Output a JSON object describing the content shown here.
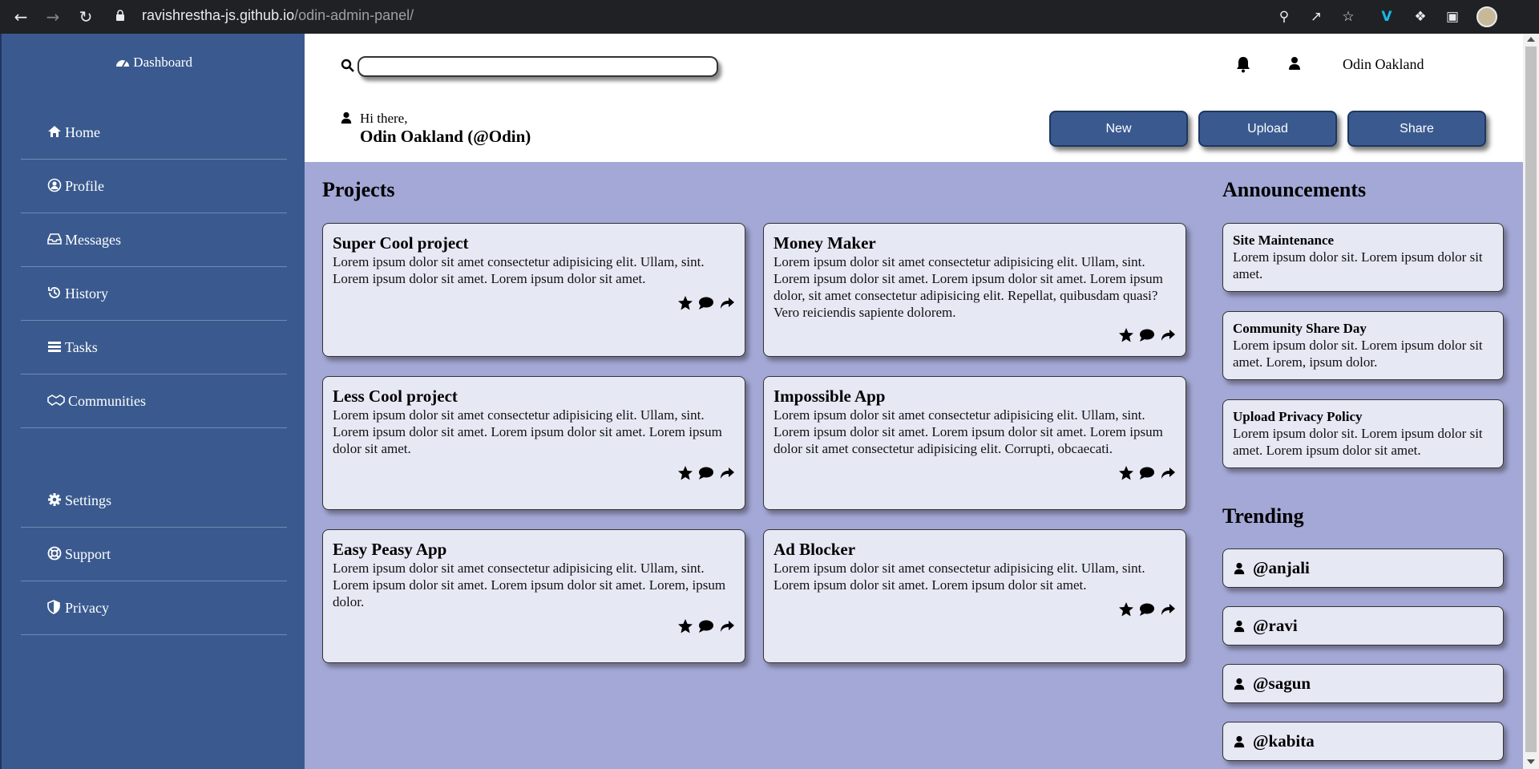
{
  "browser": {
    "url_host": "ravishrestha-js.github.io",
    "url_path": "/odin-admin-panel/"
  },
  "sidebar": {
    "dashboard_label": "Dashboard",
    "items": [
      {
        "label": "Home",
        "icon": "home-icon"
      },
      {
        "label": "Profile",
        "icon": "profile-icon"
      },
      {
        "label": "Messages",
        "icon": "inbox-icon"
      },
      {
        "label": "History",
        "icon": "history-icon"
      },
      {
        "label": "Tasks",
        "icon": "tasks-icon"
      },
      {
        "label": "Communities",
        "icon": "handshake-icon"
      }
    ],
    "bottom_items": [
      {
        "label": "Settings",
        "icon": "gear-icon"
      },
      {
        "label": "Support",
        "icon": "lifebuoy-icon"
      },
      {
        "label": "Privacy",
        "icon": "shield-icon"
      }
    ]
  },
  "header": {
    "username": "Odin Oakland",
    "greeting": "Hi there,",
    "greeting_name": "Odin Oakland (@Odin)",
    "buttons": {
      "new": "New",
      "upload": "Upload",
      "share": "Share"
    }
  },
  "projects": {
    "title": "Projects",
    "items": [
      {
        "title": "Super Cool project",
        "desc": "Lorem ipsum dolor sit amet consectetur adipisicing elit. Ullam, sint. Lorem ipsum dolor sit amet. Lorem ipsum dolor sit amet."
      },
      {
        "title": "Money Maker",
        "desc": "Lorem ipsum dolor sit amet consectetur adipisicing elit. Ullam, sint. Lorem ipsum dolor sit amet. Lorem ipsum dolor sit amet. Lorem ipsum dolor, sit amet consectetur adipisicing elit. Repellat, quibusdam quasi? Vero reiciendis sapiente dolorem."
      },
      {
        "title": "Less Cool project",
        "desc": "Lorem ipsum dolor sit amet consectetur adipisicing elit. Ullam, sint. Lorem ipsum dolor sit amet. Lorem ipsum dolor sit amet. Lorem ipsum dolor sit amet."
      },
      {
        "title": "Impossible App",
        "desc": "Lorem ipsum dolor sit amet consectetur adipisicing elit. Ullam, sint. Lorem ipsum dolor sit amet. Lorem ipsum dolor sit amet. Lorem ipsum dolor sit amet consectetur adipisicing elit. Corrupti, obcaecati."
      },
      {
        "title": "Easy Peasy App",
        "desc": "Lorem ipsum dolor sit amet consectetur adipisicing elit. Ullam, sint. Lorem ipsum dolor sit amet. Lorem ipsum dolor sit amet. Lorem, ipsum dolor."
      },
      {
        "title": "Ad Blocker",
        "desc": "Lorem ipsum dolor sit amet consectetur adipisicing elit. Ullam, sint. Lorem ipsum dolor sit amet. Lorem ipsum dolor sit amet."
      }
    ]
  },
  "announcements": {
    "title": "Announcements",
    "items": [
      {
        "title": "Site Maintenance",
        "desc": "Lorem ipsum dolor sit. Lorem ipsum dolor sit amet."
      },
      {
        "title": "Community Share Day",
        "desc": "Lorem ipsum dolor sit. Lorem ipsum dolor sit amet. Lorem, ipsum dolor."
      },
      {
        "title": "Upload Privacy Policy",
        "desc": "Lorem ipsum dolor sit. Lorem ipsum dolor sit amet. Lorem ipsum dolor sit amet."
      }
    ]
  },
  "trending": {
    "title": "Trending",
    "items": [
      "@anjali",
      "@ravi",
      "@sagun",
      "@kabita"
    ]
  },
  "colors": {
    "sidebar_bg": "#3a5a8f",
    "content_bg": "#a3a8d6",
    "card_bg": "#e6e8f4"
  }
}
